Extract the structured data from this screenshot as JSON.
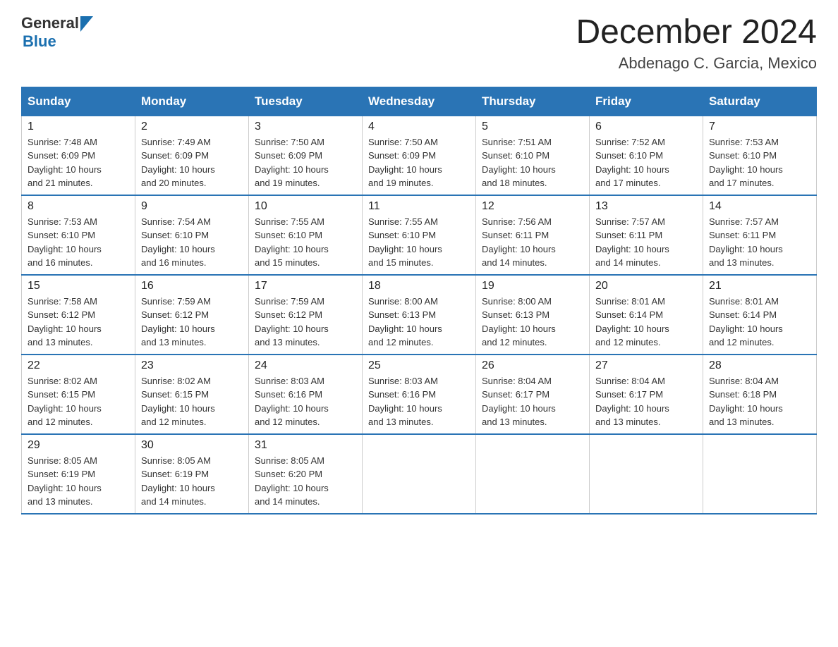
{
  "header": {
    "logo_general": "General",
    "logo_blue": "Blue",
    "month_year": "December 2024",
    "location": "Abdenago C. Garcia, Mexico"
  },
  "weekdays": [
    "Sunday",
    "Monday",
    "Tuesday",
    "Wednesday",
    "Thursday",
    "Friday",
    "Saturday"
  ],
  "weeks": [
    [
      {
        "day": "1",
        "sunrise": "7:48 AM",
        "sunset": "6:09 PM",
        "daylight": "10 hours and 21 minutes."
      },
      {
        "day": "2",
        "sunrise": "7:49 AM",
        "sunset": "6:09 PM",
        "daylight": "10 hours and 20 minutes."
      },
      {
        "day": "3",
        "sunrise": "7:50 AM",
        "sunset": "6:09 PM",
        "daylight": "10 hours and 19 minutes."
      },
      {
        "day": "4",
        "sunrise": "7:50 AM",
        "sunset": "6:09 PM",
        "daylight": "10 hours and 19 minutes."
      },
      {
        "day": "5",
        "sunrise": "7:51 AM",
        "sunset": "6:10 PM",
        "daylight": "10 hours and 18 minutes."
      },
      {
        "day": "6",
        "sunrise": "7:52 AM",
        "sunset": "6:10 PM",
        "daylight": "10 hours and 17 minutes."
      },
      {
        "day": "7",
        "sunrise": "7:53 AM",
        "sunset": "6:10 PM",
        "daylight": "10 hours and 17 minutes."
      }
    ],
    [
      {
        "day": "8",
        "sunrise": "7:53 AM",
        "sunset": "6:10 PM",
        "daylight": "10 hours and 16 minutes."
      },
      {
        "day": "9",
        "sunrise": "7:54 AM",
        "sunset": "6:10 PM",
        "daylight": "10 hours and 16 minutes."
      },
      {
        "day": "10",
        "sunrise": "7:55 AM",
        "sunset": "6:10 PM",
        "daylight": "10 hours and 15 minutes."
      },
      {
        "day": "11",
        "sunrise": "7:55 AM",
        "sunset": "6:10 PM",
        "daylight": "10 hours and 15 minutes."
      },
      {
        "day": "12",
        "sunrise": "7:56 AM",
        "sunset": "6:11 PM",
        "daylight": "10 hours and 14 minutes."
      },
      {
        "day": "13",
        "sunrise": "7:57 AM",
        "sunset": "6:11 PM",
        "daylight": "10 hours and 14 minutes."
      },
      {
        "day": "14",
        "sunrise": "7:57 AM",
        "sunset": "6:11 PM",
        "daylight": "10 hours and 13 minutes."
      }
    ],
    [
      {
        "day": "15",
        "sunrise": "7:58 AM",
        "sunset": "6:12 PM",
        "daylight": "10 hours and 13 minutes."
      },
      {
        "day": "16",
        "sunrise": "7:59 AM",
        "sunset": "6:12 PM",
        "daylight": "10 hours and 13 minutes."
      },
      {
        "day": "17",
        "sunrise": "7:59 AM",
        "sunset": "6:12 PM",
        "daylight": "10 hours and 13 minutes."
      },
      {
        "day": "18",
        "sunrise": "8:00 AM",
        "sunset": "6:13 PM",
        "daylight": "10 hours and 12 minutes."
      },
      {
        "day": "19",
        "sunrise": "8:00 AM",
        "sunset": "6:13 PM",
        "daylight": "10 hours and 12 minutes."
      },
      {
        "day": "20",
        "sunrise": "8:01 AM",
        "sunset": "6:14 PM",
        "daylight": "10 hours and 12 minutes."
      },
      {
        "day": "21",
        "sunrise": "8:01 AM",
        "sunset": "6:14 PM",
        "daylight": "10 hours and 12 minutes."
      }
    ],
    [
      {
        "day": "22",
        "sunrise": "8:02 AM",
        "sunset": "6:15 PM",
        "daylight": "10 hours and 12 minutes."
      },
      {
        "day": "23",
        "sunrise": "8:02 AM",
        "sunset": "6:15 PM",
        "daylight": "10 hours and 12 minutes."
      },
      {
        "day": "24",
        "sunrise": "8:03 AM",
        "sunset": "6:16 PM",
        "daylight": "10 hours and 12 minutes."
      },
      {
        "day": "25",
        "sunrise": "8:03 AM",
        "sunset": "6:16 PM",
        "daylight": "10 hours and 13 minutes."
      },
      {
        "day": "26",
        "sunrise": "8:04 AM",
        "sunset": "6:17 PM",
        "daylight": "10 hours and 13 minutes."
      },
      {
        "day": "27",
        "sunrise": "8:04 AM",
        "sunset": "6:17 PM",
        "daylight": "10 hours and 13 minutes."
      },
      {
        "day": "28",
        "sunrise": "8:04 AM",
        "sunset": "6:18 PM",
        "daylight": "10 hours and 13 minutes."
      }
    ],
    [
      {
        "day": "29",
        "sunrise": "8:05 AM",
        "sunset": "6:19 PM",
        "daylight": "10 hours and 13 minutes."
      },
      {
        "day": "30",
        "sunrise": "8:05 AM",
        "sunset": "6:19 PM",
        "daylight": "10 hours and 14 minutes."
      },
      {
        "day": "31",
        "sunrise": "8:05 AM",
        "sunset": "6:20 PM",
        "daylight": "10 hours and 14 minutes."
      },
      null,
      null,
      null,
      null
    ]
  ],
  "labels": {
    "sunrise": "Sunrise:",
    "sunset": "Sunset:",
    "daylight": "Daylight:"
  }
}
